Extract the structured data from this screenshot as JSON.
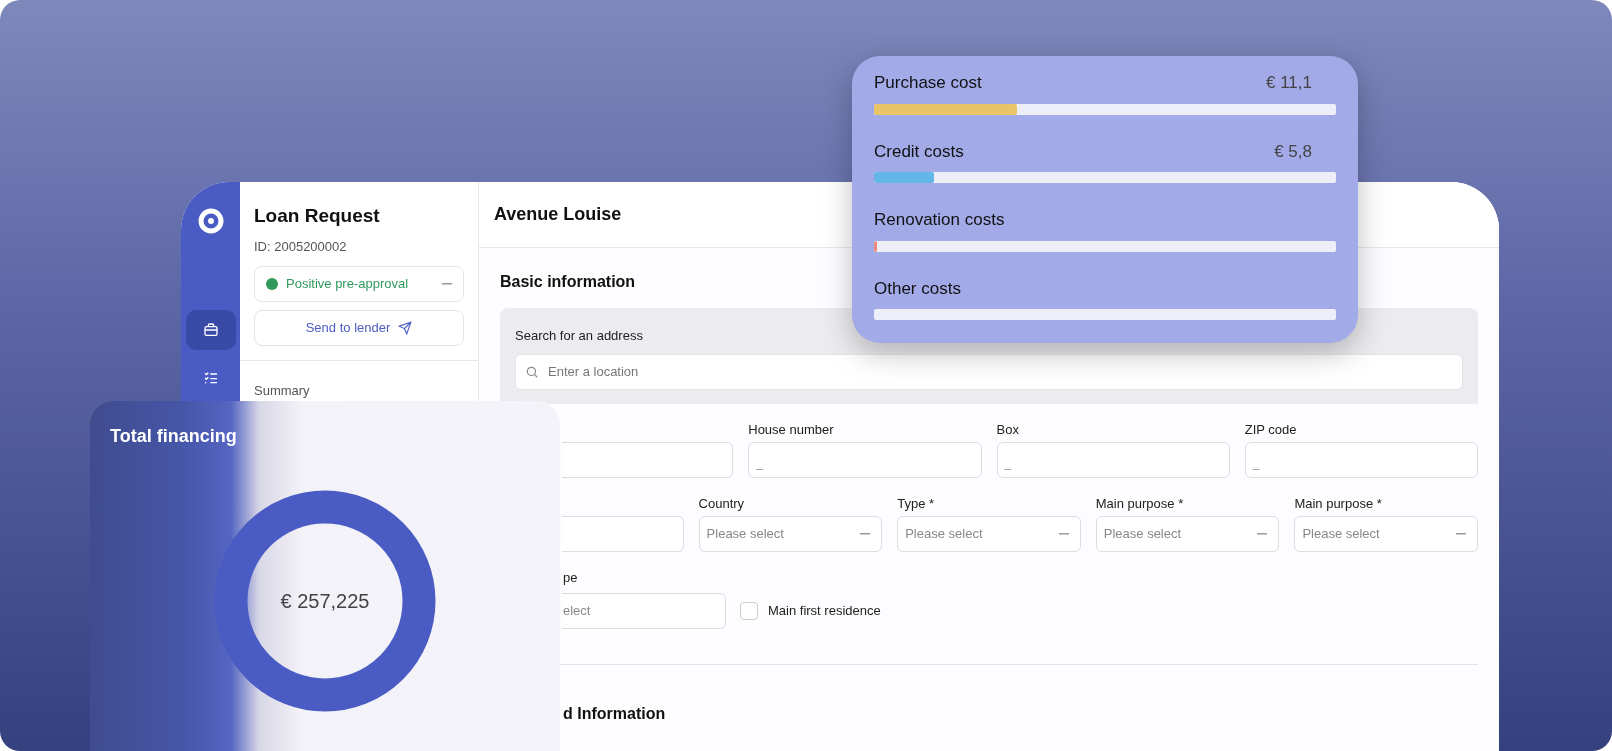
{
  "nav": [
    {
      "kind": "briefcase",
      "selected": true
    },
    {
      "kind": "checklist",
      "selected": false
    }
  ],
  "request": {
    "title": "Loan Request",
    "id": "ID: 2005200002",
    "status": "Positive pre-approval",
    "send": "Send to lender",
    "summary": "Summary"
  },
  "main": {
    "title": "Avenue Louise",
    "section": "Basic information",
    "search_label": "Search for an address",
    "search_placeholder": "Enter a location",
    "rows": [
      [
        {
          "kind": "text"
        },
        {
          "kind": "text",
          "label": "House number",
          "placeholder": "_"
        },
        {
          "kind": "text",
          "label": "Box",
          "placeholder": "_"
        },
        {
          "kind": "text",
          "label": "ZIP code",
          "placeholder": "_"
        }
      ],
      [
        {
          "kind": "text"
        },
        {
          "kind": "select",
          "label": "Country",
          "placeholder": "Please select"
        },
        {
          "kind": "select",
          "label": "Type *",
          "placeholder": "Please select"
        },
        {
          "kind": "select",
          "label": "Main purpose *",
          "placeholder": "Please select"
        },
        {
          "kind": "select",
          "label": "Main purpose *",
          "placeholder": "Please select"
        }
      ]
    ],
    "partial_field": {
      "label": "pe",
      "placeholder": "elect"
    },
    "checkbox": {
      "label": "Main first residence",
      "checked": false
    },
    "section2": "d Information"
  },
  "costs": [
    {
      "label": "Purchase cost",
      "value": "€ 11,1",
      "level": 0.31,
      "color": "#ecc468"
    },
    {
      "label": "Credit costs",
      "value": "€ 5,8",
      "level": 0.13,
      "color": "#62b6e8"
    },
    {
      "label": "Renovation costs",
      "level": 0.005,
      "color": "#f08a80"
    },
    {
      "label": "Other costs"
    }
  ],
  "total": {
    "title": "Total financing",
    "amount": "€ 257,225"
  }
}
